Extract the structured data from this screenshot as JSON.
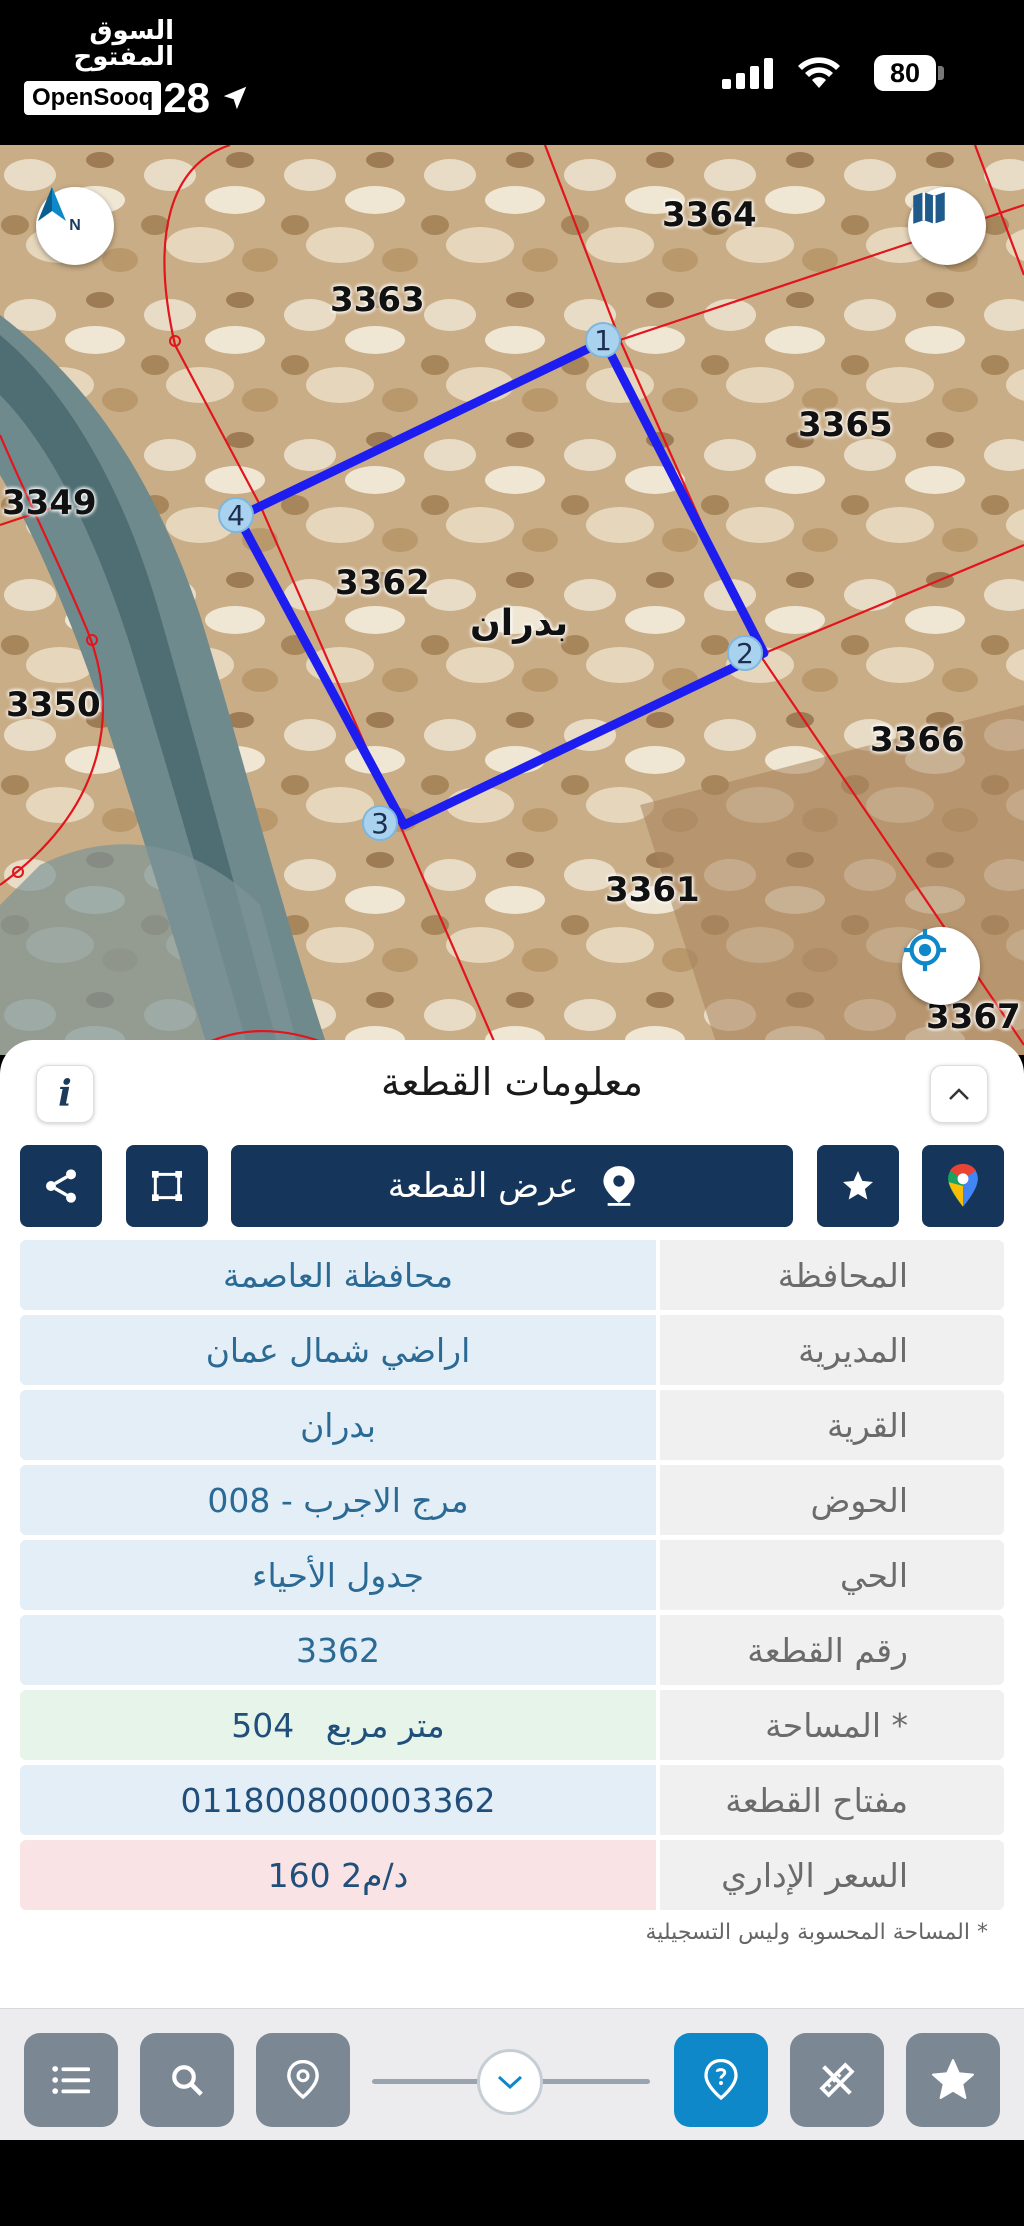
{
  "status_bar": {
    "brand_ar": "السوق المفتوح",
    "brand_en": "OpenSooq",
    "time": "28",
    "battery": "80"
  },
  "map": {
    "north_label": "N",
    "parcels": [
      "3364",
      "3363",
      "3365",
      "3349",
      "3362",
      "3366",
      "3350",
      "3361",
      "3367"
    ],
    "village_label": "بدران",
    "vertices": [
      "1",
      "2",
      "3",
      "4"
    ]
  },
  "sheet": {
    "title": "معلومات القطعة",
    "info_label": "i",
    "view_parcel_label": "عرض القطعة",
    "rows": [
      {
        "key": "المحافظة",
        "value": "محافظة العاصمة"
      },
      {
        "key": "المديرية",
        "value": "اراضي شمال عمان"
      },
      {
        "key": "القرية",
        "value": "بدران"
      },
      {
        "key": "الحوض",
        "value": "مرج الاجرب - 008"
      },
      {
        "key": "الحي",
        "value": "جدول الأحياء"
      },
      {
        "key": "رقم القطعة",
        "value": "3362"
      },
      {
        "key": "المساحة *",
        "value": "504   متر مربع"
      },
      {
        "key": "مفتاح القطعة",
        "value": "011800800003362"
      },
      {
        "key": "السعر الإداري",
        "value": "160 د/م2"
      }
    ],
    "note": "* المساحة المحسوبة وليس التسجيلية"
  },
  "colors": {
    "navy": "#15365a",
    "teal": "#0e88c8",
    "parcel_outline": "#1d1df0",
    "boundary": "#e3141c"
  }
}
